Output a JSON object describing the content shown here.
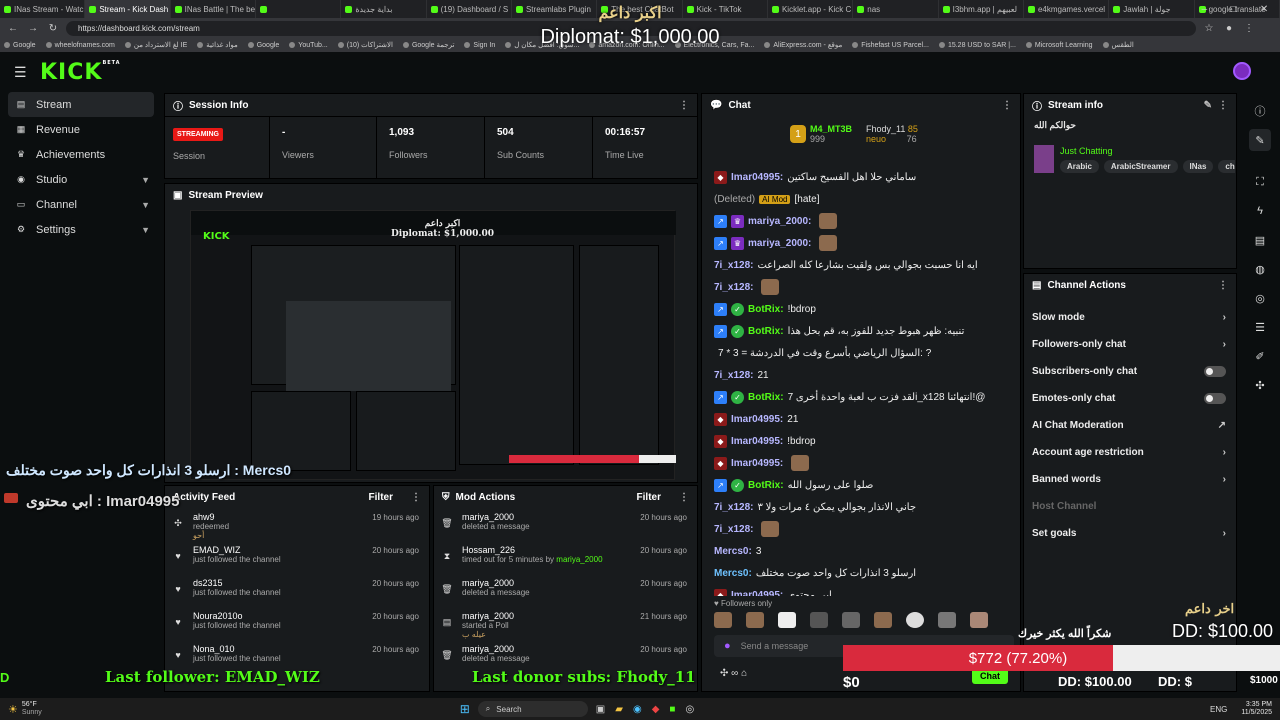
{
  "browser": {
    "tabs": [
      "INas Stream - Watch",
      "Stream - Kick Dash",
      "INas Battle | The be",
      "",
      "بداية جديدة",
      "(19) Dashboard / S",
      "Streamlabs Plugin",
      "The best ChatBot",
      "Kick - TikTok",
      "Kicklet.app - Kick C",
      "nas",
      "I3bhm.app | لعبيهم",
      "e4kmgames.vercel",
      "Jawlah | جولة",
      "google translate"
    ],
    "url": "https://dashboard.kick.com/stream",
    "bookmarks": [
      "Google",
      "wheelofnames.com",
      "لغ الاسترداد من IE",
      "مواد غذائية",
      "Google",
      "YouTub...",
      "الاشتراكات (10)",
      "Google ترجمة",
      "Sign In",
      "سوق: افضل مكان ل...",
      "amazon.com: Onlin...",
      "Electronics, Cars, Fa...",
      "AliExpress.com - موقع",
      "Fishefast US Parcel...",
      "15.28 USD to SAR |...",
      "Microsoft Learning",
      "الطقس"
    ]
  },
  "app": {
    "logo": "KICK",
    "beta": "BETA"
  },
  "sidebar": {
    "items": [
      {
        "label": "Stream",
        "icon": "stream-icon"
      },
      {
        "label": "Revenue",
        "icon": "revenue-icon"
      },
      {
        "label": "Achievements",
        "icon": "trophy-icon"
      },
      {
        "label": "Studio",
        "icon": "studio-icon"
      },
      {
        "label": "Channel",
        "icon": "channel-icon"
      },
      {
        "label": "Settings",
        "icon": "gear-icon"
      }
    ]
  },
  "session": {
    "title": "Session Info",
    "status": "STREAMING",
    "session_label": "Session",
    "viewers_val": "-",
    "viewers_label": "Viewers",
    "followers_val": "1,093",
    "followers_label": "Followers",
    "subs_val": "504",
    "subs_label": "Sub Counts",
    "time_val": "00:16:57",
    "time_label": "Time Live"
  },
  "preview": {
    "title": "Stream Preview",
    "overlay_top": "اكبر داعم",
    "overlay_amount": "Diplomat: $1,000.00"
  },
  "overlays": {
    "top_title": "اكبر داعم",
    "top_amount": "Diplomat: $1,000.00",
    "left_msg": "ارسلو 3 انذارات كل واحد صوت مختلف : Mercs0",
    "left_msg2": "ابي محتوى : Imar04995",
    "last_follower": "Last follower: EMAD_WIZ",
    "last_donor": "Last donor subs: Fhody_11",
    "right_title": "اخر داعم",
    "right_amount": "DD: $100.00",
    "thanks": "شكراً الله يكثر خيرك",
    "goal": "$772 (77.20%)",
    "goal_pct": 77.2,
    "zero": "$0",
    "ticker1": "DD: $100.00",
    "ticker2": "DD: $",
    "side_amount": "$1000",
    "left_edge": "D"
  },
  "feed": {
    "title": "Activity Feed",
    "filter": "Filter",
    "items": [
      {
        "name": "ahw9",
        "sub": "redeemed",
        "extra": "أحو",
        "time": "19 hours ago",
        "icon": "gift-icon"
      },
      {
        "name": "EMAD_WIZ",
        "sub": "just followed the channel",
        "time": "20 hours ago",
        "icon": "heart-icon"
      },
      {
        "name": "ds2315",
        "sub": "just followed the channel",
        "time": "20 hours ago",
        "icon": "heart-icon"
      },
      {
        "name": "Noura2010o",
        "sub": "just followed the channel",
        "time": "20 hours ago",
        "icon": "heart-icon"
      },
      {
        "name": "Nona_010",
        "sub": "just followed the channel",
        "time": "20 hours ago",
        "icon": "heart-icon"
      }
    ]
  },
  "mod": {
    "title": "Mod Actions",
    "filter": "Filter",
    "items": [
      {
        "name": "mariya_2000",
        "sub": "deleted a message",
        "time": "20 hours ago",
        "icon": "trash-icon"
      },
      {
        "name": "Hossam_226",
        "sub": "timed out for 5 minutes by",
        "by": "mariya_2000",
        "time": "20 hours ago",
        "icon": "hourglass-icon"
      },
      {
        "name": "mariya_2000",
        "sub": "deleted a message",
        "time": "20 hours ago",
        "icon": "trash-icon"
      },
      {
        "name": "mariya_2000",
        "sub": "started a Poll",
        "extra": "عيله ب",
        "time": "21 hours ago",
        "icon": "poll-icon"
      },
      {
        "name": "mariya_2000",
        "sub": "deleted a message",
        "time": "20 hours ago",
        "icon": "trash-icon"
      }
    ]
  },
  "chat": {
    "title": "Chat",
    "leader1": "M4_MT3B",
    "leader1_val": "999",
    "leader2": "Fhody_11",
    "leader2_val": "85",
    "leader3": "neuo",
    "leader3_val": "76",
    "lines": [
      {
        "user": "Imar04995:",
        "text": "ساماني حلا اهل الفسيح ساكتين",
        "cls": "cu"
      },
      {
        "user": "(Deleted)",
        "text": "[hate]",
        "mod": "AI Mod",
        "cls": "sub"
      },
      {
        "user": "mariya_2000:",
        "text": "",
        "cls": "cu"
      },
      {
        "user": "mariya_2000:",
        "text": "",
        "cls": "cu"
      },
      {
        "user": "7i_x128:",
        "text": "ايه انا حسبت بجوالي بس ولقيت بشارعا كله الصراعت",
        "cls": "cu"
      },
      {
        "user": "7i_x128:",
        "text": "",
        "cls": "cu"
      },
      {
        "user": "BotRix:",
        "text": "!bdrop",
        "cls": "cu green"
      },
      {
        "user": "BotRix:",
        "text": "تنبيه: ظهر هبوط جديد  للفوز به، قم بحل هذا",
        "cls": "cu green"
      },
      {
        "user": "",
        "text": "7 * 3 = السؤال الرياضي بأسرع وقت في الدردشة: ?",
        "cls": "cu"
      },
      {
        "user": "7i_x128:",
        "text": "21",
        "cls": "cu"
      },
      {
        "user": "BotRix:",
        "text": "لقد فزت ب لعبة واحدة أخرى 7i_x128 انتهائنا!@",
        "cls": "cu green"
      },
      {
        "user": "Imar04995:",
        "text": "21",
        "cls": "cu"
      },
      {
        "user": "Imar04995:",
        "text": "!bdrop",
        "cls": "cu"
      },
      {
        "user": "Imar04995:",
        "text": "",
        "cls": "cu"
      },
      {
        "user": "BotRix:",
        "text": "صلوا على رسول الله",
        "cls": "cu green"
      },
      {
        "user": "7i_x128:",
        "text": "جاني الانذار بجوالي يمكن ٤ مرات ولا ٣",
        "cls": "cu"
      },
      {
        "user": "7i_x128:",
        "text": "",
        "cls": "cu"
      },
      {
        "user": "Mercs0:",
        "text": "3",
        "cls": "cu"
      },
      {
        "user": "Mercs0:",
        "text": "ارسلو 3 انذارات كل واحد صوت مختلف",
        "cls": "cu blue"
      },
      {
        "user": "Imar04995:",
        "text": "ابي محتوى",
        "cls": "cu"
      }
    ],
    "followers_only": "Followers only",
    "placeholder": "Send a message",
    "send": "Chat"
  },
  "streaminfo": {
    "title": "Stream info",
    "stream_title": "حوالكم الله",
    "category": "Just Chatting",
    "tags": [
      "Arabic",
      "ArabicStreamer",
      "INas",
      "chillin"
    ]
  },
  "actions": {
    "title": "Channel Actions",
    "items": [
      {
        "label": "Slow mode",
        "type": "chevron"
      },
      {
        "label": "Followers-only chat",
        "type": "chevron"
      },
      {
        "label": "Subscribers-only chat",
        "type": "toggle"
      },
      {
        "label": "Emotes-only chat",
        "type": "toggle"
      },
      {
        "label": "AI Chat Moderation",
        "type": "link"
      },
      {
        "label": "Account age restriction",
        "type": "chevron"
      },
      {
        "label": "Banned words",
        "type": "chevron"
      },
      {
        "label": "Host Channel",
        "type": "disabled"
      },
      {
        "label": "Set goals",
        "type": "chevron"
      }
    ]
  },
  "taskbar": {
    "weather": "56°F",
    "weather_sub": "Sunny",
    "search": "Search",
    "time": "3:35 PM",
    "date": "11/5/2025",
    "lang": "ENG"
  }
}
